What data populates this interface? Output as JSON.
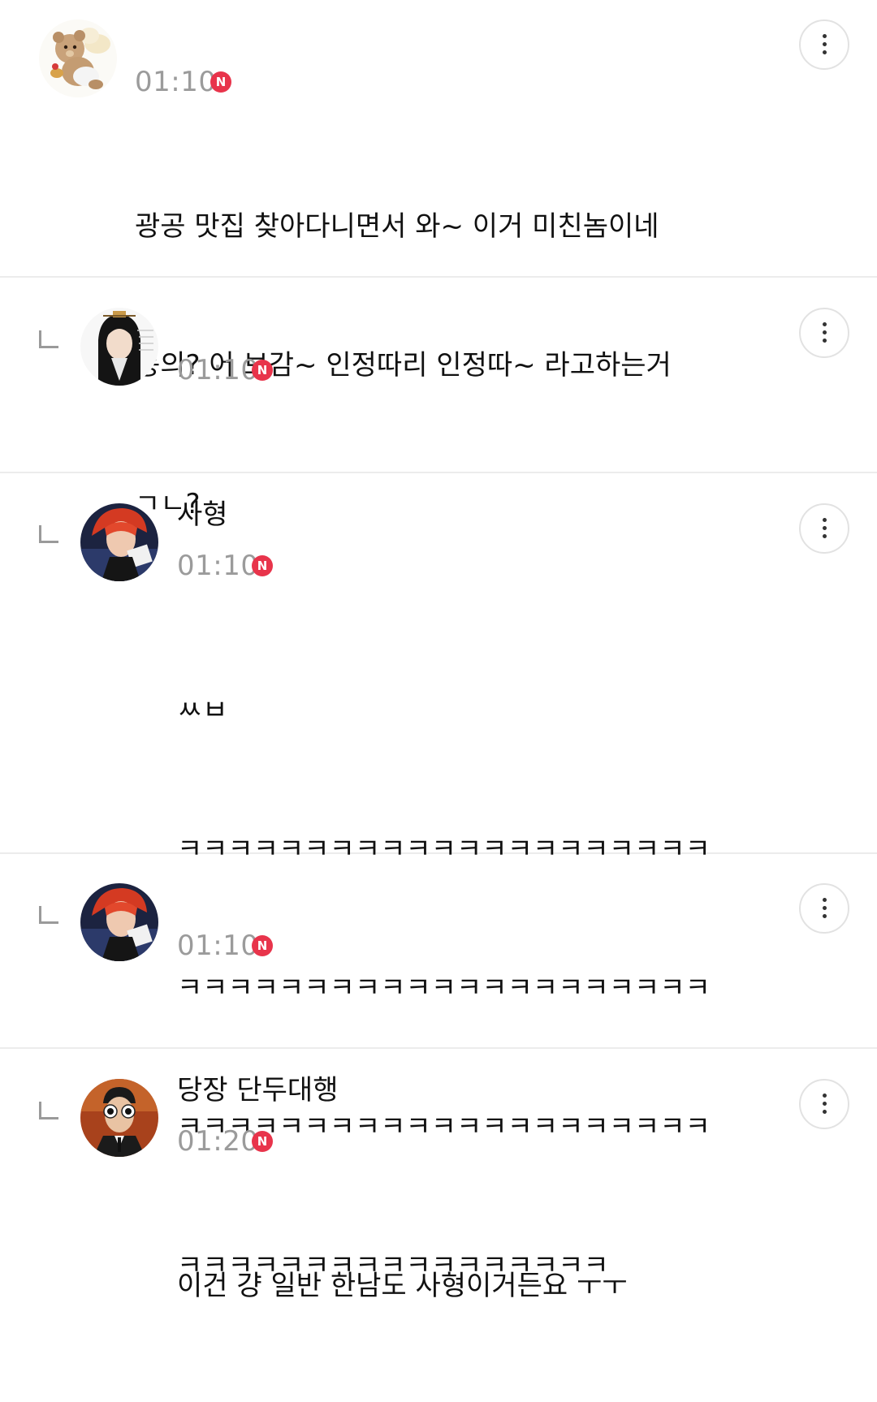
{
  "comments": [
    {
      "avatar_icon": "teddy-bear-angel-avatar",
      "time": "01:10",
      "badge": "N",
      "lines": [
        "광공 맛집 찾아다니면서 와~ 이거 미친놈이네",
        "동의? 어 보감~ 인정따리 인정따~ 라고하는거",
        "ㄱㄴ?"
      ]
    },
    {
      "is_reply": true,
      "avatar_icon": "anime-character-avatar",
      "time": "01:10",
      "badge": "N",
      "lines": [
        "사형"
      ]
    },
    {
      "is_reply": true,
      "avatar_icon": "red-hair-idol-avatar",
      "time": "01:10",
      "badge": "N",
      "lines": [
        "ㅆㅂ",
        "ㅋㅋㅋㅋㅋㅋㅋㅋㅋㅋㅋㅋㅋㅋㅋㅋㅋㅋㅋㅋㅋ",
        "ㅋㅋㅋㅋㅋㅋㅋㅋㅋㅋㅋㅋㅋㅋㅋㅋㅋㅋㅋㅋㅋ",
        "ㅋㅋㅋㅋㅋㅋㅋㅋㅋㅋㅋㅋㅋㅋㅋㅋㅋㅋㅋㅋㅋ",
        "ㅋㅋㅋㅋㅋㅋㅋㅋㅋㅋㅋㅋㅋㅋㅋㅋㅋ"
      ]
    },
    {
      "is_reply": true,
      "avatar_icon": "red-hair-idol-avatar",
      "time": "01:10",
      "badge": "N",
      "lines": [
        "당장 단두대행"
      ]
    },
    {
      "is_reply": true,
      "avatar_icon": "sunglasses-man-avatar",
      "time": "01:20",
      "badge": "N",
      "lines": [
        "이건 걍 일반 한남도 사형이거든요 ㅜㅜ"
      ]
    }
  ],
  "colors": {
    "badge": "#e8344b",
    "time": "#9b9b9b",
    "divider": "#ececec"
  }
}
